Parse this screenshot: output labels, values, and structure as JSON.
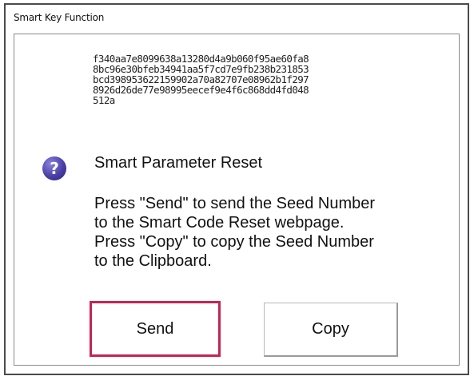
{
  "window": {
    "title": "Smart Key Function"
  },
  "seed": {
    "lines": [
      "f340aa7e8099638a13280d4a9b060f95ae60fa8",
      "8bc96e30bfeb34941aa5f7cd7e9fb238b231853",
      "bcd398953622159902a70a82707e08962b1f297",
      "8926d26de77e98995eecef9e4f6c868dd4fd048",
      "512a"
    ]
  },
  "icon": {
    "name": "question-icon",
    "glyph": "?",
    "color": "#4b3fa8"
  },
  "message": {
    "heading": "Smart Parameter Reset",
    "lines": [
      "Press \"Send\" to send the Seed Number",
      "to the Smart Code Reset webpage.",
      "Press \"Copy\" to copy the Seed Number",
      "to the Clipboard."
    ]
  },
  "buttons": {
    "send_label": "Send",
    "copy_label": "Copy",
    "focus_color": "#c4254f"
  }
}
